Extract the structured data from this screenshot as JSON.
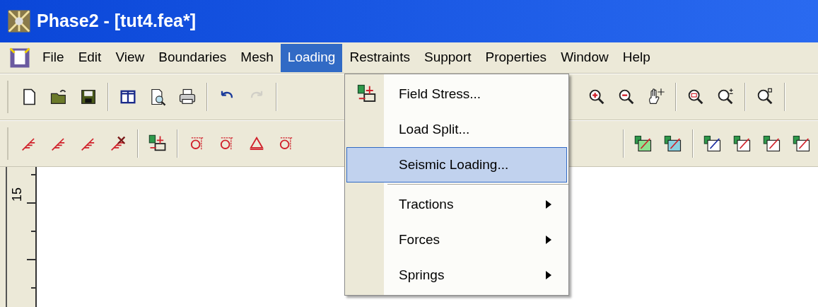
{
  "window": {
    "title": "Phase2 - [tut4.fea*]"
  },
  "menu_bar": [
    {
      "label": "File",
      "selected": false
    },
    {
      "label": "Edit",
      "selected": false
    },
    {
      "label": "View",
      "selected": false
    },
    {
      "label": "Boundaries",
      "selected": false
    },
    {
      "label": "Mesh",
      "selected": false
    },
    {
      "label": "Loading",
      "selected": true
    },
    {
      "label": "Restraints",
      "selected": false
    },
    {
      "label": "Support",
      "selected": false
    },
    {
      "label": "Properties",
      "selected": false
    },
    {
      "label": "Window",
      "selected": false
    },
    {
      "label": "Help",
      "selected": false
    }
  ],
  "toolbars": [
    {
      "left": [
        {
          "kind": "new",
          "disabled": false
        },
        {
          "kind": "open",
          "disabled": false
        },
        {
          "kind": "save",
          "disabled": false
        },
        {
          "kind": "separator"
        },
        {
          "kind": "layout",
          "disabled": false
        },
        {
          "kind": "preview",
          "disabled": false
        },
        {
          "kind": "print",
          "disabled": false
        },
        {
          "kind": "separator"
        },
        {
          "kind": "undo",
          "disabled": false
        },
        {
          "kind": "redo",
          "disabled": true
        },
        {
          "kind": "separator"
        }
      ],
      "right": [
        {
          "kind": "zoom-in",
          "disabled": false
        },
        {
          "kind": "zoom-out",
          "disabled": false
        },
        {
          "kind": "pan",
          "disabled": false
        },
        {
          "kind": "separator"
        },
        {
          "kind": "zoom-window",
          "disabled": false
        },
        {
          "kind": "zoom-plusminus",
          "disabled": false
        },
        {
          "kind": "separator"
        },
        {
          "kind": "zoom-extents",
          "disabled": false
        },
        {
          "kind": "separator"
        }
      ]
    },
    {
      "left": [
        {
          "kind": "boundary-a",
          "disabled": false
        },
        {
          "kind": "boundary-b",
          "disabled": false
        },
        {
          "kind": "boundary-c",
          "disabled": false
        },
        {
          "kind": "boundary-d",
          "disabled": false
        },
        {
          "kind": "separator"
        },
        {
          "kind": "field-stress",
          "disabled": false
        },
        {
          "kind": "separator"
        },
        {
          "kind": "restraint-a",
          "disabled": false
        },
        {
          "kind": "restraint-b",
          "disabled": false
        },
        {
          "kind": "restraint-c",
          "disabled": false
        },
        {
          "kind": "restraint-d",
          "disabled": false
        }
      ],
      "right": [
        {
          "kind": "separator"
        },
        {
          "kind": "prop-a",
          "disabled": false
        },
        {
          "kind": "prop-b",
          "disabled": false
        },
        {
          "kind": "separator"
        },
        {
          "kind": "prop-c",
          "disabled": false
        },
        {
          "kind": "prop-d",
          "disabled": false
        },
        {
          "kind": "prop-e",
          "disabled": false
        },
        {
          "kind": "prop-f",
          "disabled": false
        }
      ]
    }
  ],
  "loading_menu": {
    "items": [
      {
        "kind": "command",
        "label": "Field Stress...",
        "icon": true,
        "selected": false
      },
      {
        "kind": "command",
        "label": "Load Split...",
        "icon": false,
        "selected": false
      },
      {
        "kind": "command",
        "label": "Seismic Loading...",
        "icon": false,
        "selected": true
      },
      {
        "kind": "separator"
      },
      {
        "kind": "submenu",
        "label": "Tractions",
        "icon": false,
        "selected": false
      },
      {
        "kind": "submenu",
        "label": "Forces",
        "icon": false,
        "selected": false
      },
      {
        "kind": "submenu",
        "label": "Springs",
        "icon": false,
        "selected": false
      }
    ]
  },
  "ruler": {
    "labels": [
      "15"
    ]
  }
}
